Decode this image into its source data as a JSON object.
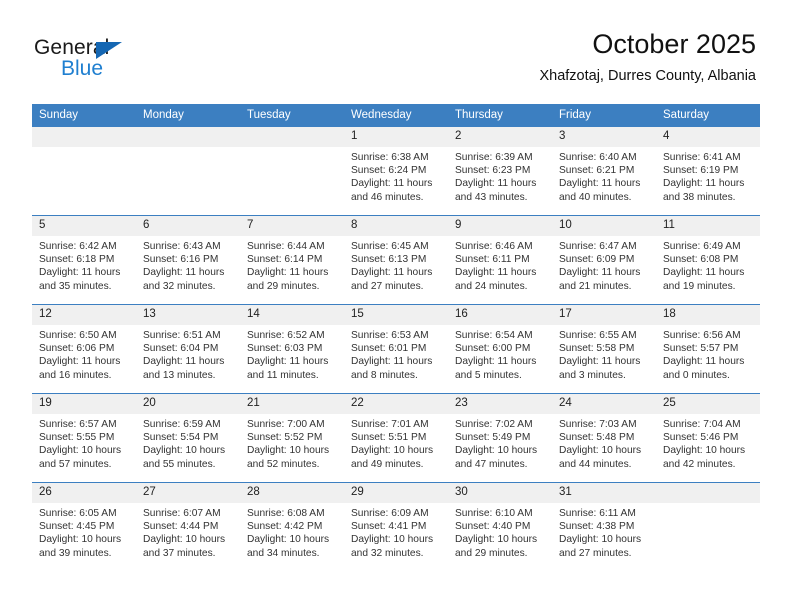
{
  "brand": {
    "name_part1": "General",
    "name_part2": "Blue",
    "accent_color": "#1f7fd0",
    "triangle_color": "#1567b3"
  },
  "header": {
    "title": "October 2025",
    "subtitle": "Xhafzotaj, Durres County, Albania"
  },
  "calendar": {
    "header_bg": "#3c7fc1",
    "daynum_bg": "#f0f0f0",
    "weekdays": [
      "Sunday",
      "Monday",
      "Tuesday",
      "Wednesday",
      "Thursday",
      "Friday",
      "Saturday"
    ],
    "labels": {
      "sunrise": "Sunrise:",
      "sunset": "Sunset:",
      "daylight": "Daylight:"
    },
    "weeks": [
      [
        {
          "day": "",
          "sunrise": "",
          "sunset": "",
          "daylight_line1": "",
          "daylight_line2": ""
        },
        {
          "day": "",
          "sunrise": "",
          "sunset": "",
          "daylight_line1": "",
          "daylight_line2": ""
        },
        {
          "day": "",
          "sunrise": "",
          "sunset": "",
          "daylight_line1": "",
          "daylight_line2": ""
        },
        {
          "day": "1",
          "sunrise": "Sunrise: 6:38 AM",
          "sunset": "Sunset: 6:24 PM",
          "daylight_line1": "Daylight: 11 hours",
          "daylight_line2": "and 46 minutes."
        },
        {
          "day": "2",
          "sunrise": "Sunrise: 6:39 AM",
          "sunset": "Sunset: 6:23 PM",
          "daylight_line1": "Daylight: 11 hours",
          "daylight_line2": "and 43 minutes."
        },
        {
          "day": "3",
          "sunrise": "Sunrise: 6:40 AM",
          "sunset": "Sunset: 6:21 PM",
          "daylight_line1": "Daylight: 11 hours",
          "daylight_line2": "and 40 minutes."
        },
        {
          "day": "4",
          "sunrise": "Sunrise: 6:41 AM",
          "sunset": "Sunset: 6:19 PM",
          "daylight_line1": "Daylight: 11 hours",
          "daylight_line2": "and 38 minutes."
        }
      ],
      [
        {
          "day": "5",
          "sunrise": "Sunrise: 6:42 AM",
          "sunset": "Sunset: 6:18 PM",
          "daylight_line1": "Daylight: 11 hours",
          "daylight_line2": "and 35 minutes."
        },
        {
          "day": "6",
          "sunrise": "Sunrise: 6:43 AM",
          "sunset": "Sunset: 6:16 PM",
          "daylight_line1": "Daylight: 11 hours",
          "daylight_line2": "and 32 minutes."
        },
        {
          "day": "7",
          "sunrise": "Sunrise: 6:44 AM",
          "sunset": "Sunset: 6:14 PM",
          "daylight_line1": "Daylight: 11 hours",
          "daylight_line2": "and 29 minutes."
        },
        {
          "day": "8",
          "sunrise": "Sunrise: 6:45 AM",
          "sunset": "Sunset: 6:13 PM",
          "daylight_line1": "Daylight: 11 hours",
          "daylight_line2": "and 27 minutes."
        },
        {
          "day": "9",
          "sunrise": "Sunrise: 6:46 AM",
          "sunset": "Sunset: 6:11 PM",
          "daylight_line1": "Daylight: 11 hours",
          "daylight_line2": "and 24 minutes."
        },
        {
          "day": "10",
          "sunrise": "Sunrise: 6:47 AM",
          "sunset": "Sunset: 6:09 PM",
          "daylight_line1": "Daylight: 11 hours",
          "daylight_line2": "and 21 minutes."
        },
        {
          "day": "11",
          "sunrise": "Sunrise: 6:49 AM",
          "sunset": "Sunset: 6:08 PM",
          "daylight_line1": "Daylight: 11 hours",
          "daylight_line2": "and 19 minutes."
        }
      ],
      [
        {
          "day": "12",
          "sunrise": "Sunrise: 6:50 AM",
          "sunset": "Sunset: 6:06 PM",
          "daylight_line1": "Daylight: 11 hours",
          "daylight_line2": "and 16 minutes."
        },
        {
          "day": "13",
          "sunrise": "Sunrise: 6:51 AM",
          "sunset": "Sunset: 6:04 PM",
          "daylight_line1": "Daylight: 11 hours",
          "daylight_line2": "and 13 minutes."
        },
        {
          "day": "14",
          "sunrise": "Sunrise: 6:52 AM",
          "sunset": "Sunset: 6:03 PM",
          "daylight_line1": "Daylight: 11 hours",
          "daylight_line2": "and 11 minutes."
        },
        {
          "day": "15",
          "sunrise": "Sunrise: 6:53 AM",
          "sunset": "Sunset: 6:01 PM",
          "daylight_line1": "Daylight: 11 hours",
          "daylight_line2": "and 8 minutes."
        },
        {
          "day": "16",
          "sunrise": "Sunrise: 6:54 AM",
          "sunset": "Sunset: 6:00 PM",
          "daylight_line1": "Daylight: 11 hours",
          "daylight_line2": "and 5 minutes."
        },
        {
          "day": "17",
          "sunrise": "Sunrise: 6:55 AM",
          "sunset": "Sunset: 5:58 PM",
          "daylight_line1": "Daylight: 11 hours",
          "daylight_line2": "and 3 minutes."
        },
        {
          "day": "18",
          "sunrise": "Sunrise: 6:56 AM",
          "sunset": "Sunset: 5:57 PM",
          "daylight_line1": "Daylight: 11 hours",
          "daylight_line2": "and 0 minutes."
        }
      ],
      [
        {
          "day": "19",
          "sunrise": "Sunrise: 6:57 AM",
          "sunset": "Sunset: 5:55 PM",
          "daylight_line1": "Daylight: 10 hours",
          "daylight_line2": "and 57 minutes."
        },
        {
          "day": "20",
          "sunrise": "Sunrise: 6:59 AM",
          "sunset": "Sunset: 5:54 PM",
          "daylight_line1": "Daylight: 10 hours",
          "daylight_line2": "and 55 minutes."
        },
        {
          "day": "21",
          "sunrise": "Sunrise: 7:00 AM",
          "sunset": "Sunset: 5:52 PM",
          "daylight_line1": "Daylight: 10 hours",
          "daylight_line2": "and 52 minutes."
        },
        {
          "day": "22",
          "sunrise": "Sunrise: 7:01 AM",
          "sunset": "Sunset: 5:51 PM",
          "daylight_line1": "Daylight: 10 hours",
          "daylight_line2": "and 49 minutes."
        },
        {
          "day": "23",
          "sunrise": "Sunrise: 7:02 AM",
          "sunset": "Sunset: 5:49 PM",
          "daylight_line1": "Daylight: 10 hours",
          "daylight_line2": "and 47 minutes."
        },
        {
          "day": "24",
          "sunrise": "Sunrise: 7:03 AM",
          "sunset": "Sunset: 5:48 PM",
          "daylight_line1": "Daylight: 10 hours",
          "daylight_line2": "and 44 minutes."
        },
        {
          "day": "25",
          "sunrise": "Sunrise: 7:04 AM",
          "sunset": "Sunset: 5:46 PM",
          "daylight_line1": "Daylight: 10 hours",
          "daylight_line2": "and 42 minutes."
        }
      ],
      [
        {
          "day": "26",
          "sunrise": "Sunrise: 6:05 AM",
          "sunset": "Sunset: 4:45 PM",
          "daylight_line1": "Daylight: 10 hours",
          "daylight_line2": "and 39 minutes."
        },
        {
          "day": "27",
          "sunrise": "Sunrise: 6:07 AM",
          "sunset": "Sunset: 4:44 PM",
          "daylight_line1": "Daylight: 10 hours",
          "daylight_line2": "and 37 minutes."
        },
        {
          "day": "28",
          "sunrise": "Sunrise: 6:08 AM",
          "sunset": "Sunset: 4:42 PM",
          "daylight_line1": "Daylight: 10 hours",
          "daylight_line2": "and 34 minutes."
        },
        {
          "day": "29",
          "sunrise": "Sunrise: 6:09 AM",
          "sunset": "Sunset: 4:41 PM",
          "daylight_line1": "Daylight: 10 hours",
          "daylight_line2": "and 32 minutes."
        },
        {
          "day": "30",
          "sunrise": "Sunrise: 6:10 AM",
          "sunset": "Sunset: 4:40 PM",
          "daylight_line1": "Daylight: 10 hours",
          "daylight_line2": "and 29 minutes."
        },
        {
          "day": "31",
          "sunrise": "Sunrise: 6:11 AM",
          "sunset": "Sunset: 4:38 PM",
          "daylight_line1": "Daylight: 10 hours",
          "daylight_line2": "and 27 minutes."
        },
        {
          "day": "",
          "sunrise": "",
          "sunset": "",
          "daylight_line1": "",
          "daylight_line2": ""
        }
      ]
    ]
  }
}
